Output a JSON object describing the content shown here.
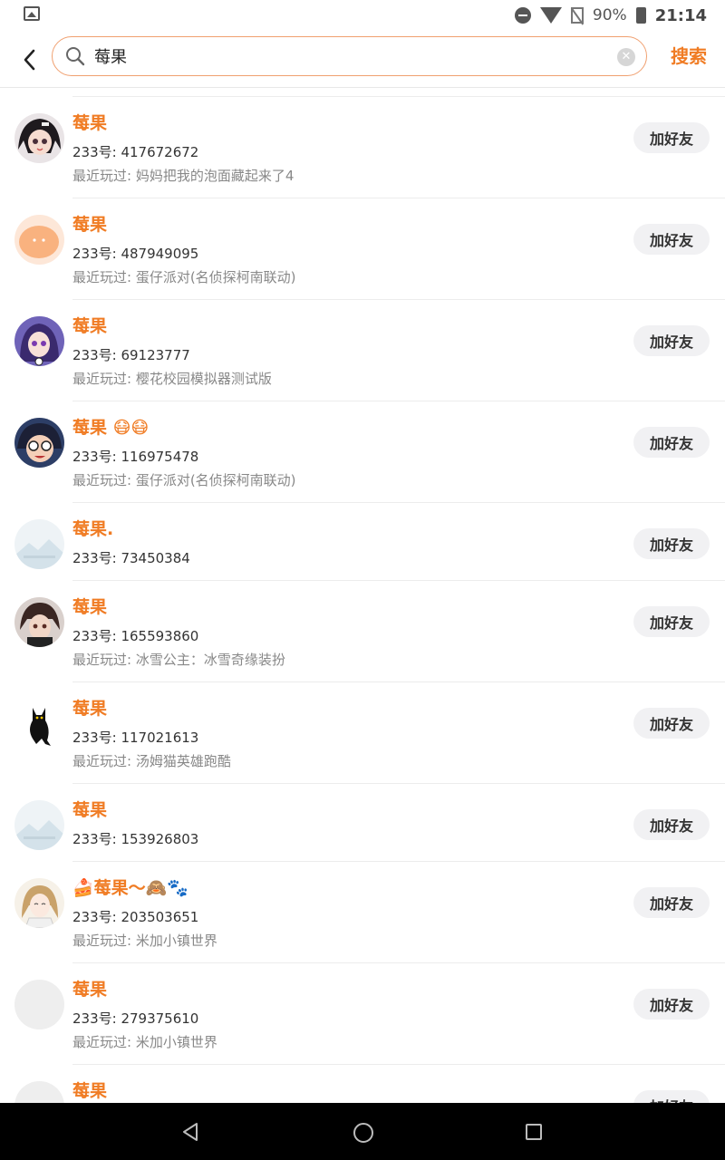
{
  "status_bar": {
    "battery": "90%",
    "time": "21:14"
  },
  "search": {
    "query": "莓果",
    "placeholder": "",
    "button_label": "搜索"
  },
  "results": [
    {
      "name": "莓果",
      "uid": "233号: 417672672",
      "recent": "最近玩过: 妈妈把我的泡面藏起来了4",
      "action": "加好友",
      "avatar": "anime-girl-dark-hair"
    },
    {
      "name": "莓果",
      "uid": "233号: 487949095",
      "recent": "最近玩过: 蛋仔派对(名侦探柯南联动)",
      "action": "加好友",
      "avatar": "orange-blob"
    },
    {
      "name": "莓果",
      "uid": "233号: 69123777",
      "recent": "最近玩过: 樱花校园模拟器测试版",
      "action": "加好友",
      "avatar": "anime-girl-purple"
    },
    {
      "name": "莓果 😷😷",
      "uid": "233号: 116975478",
      "recent": "最近玩过: 蛋仔派对(名侦探柯南联动)",
      "action": "加好友",
      "avatar": "anime-boy-glasses"
    },
    {
      "name": "莓果.",
      "uid": "233号: 73450384",
      "recent": "",
      "action": "加好友",
      "avatar": "default-landscape"
    },
    {
      "name": "莓果",
      "uid": "233号: 165593860",
      "recent": "最近玩过: 冰雪公主：冰雪奇缘装扮",
      "action": "加好友",
      "avatar": "anime-boy-brown"
    },
    {
      "name": "莓果",
      "uid": "233号: 117021613",
      "recent": "最近玩过: 汤姆猫英雄跑酷",
      "action": "加好友",
      "avatar": "black-cat"
    },
    {
      "name": "莓果",
      "uid": "233号: 153926803",
      "recent": "",
      "action": "加好友",
      "avatar": "default-landscape"
    },
    {
      "name": "🍰莓果〜🙈🐾",
      "uid": "233号: 203503651",
      "recent": "最近玩过: 米加小镇世界",
      "action": "加好友",
      "avatar": "anime-girl-light"
    },
    {
      "name": "莓果",
      "uid": "233号: 279375610",
      "recent": "最近玩过: 米加小镇世界",
      "action": "加好友",
      "avatar": "blank-grey"
    },
    {
      "name": "莓果",
      "uid": "",
      "recent": "",
      "action": "加好友",
      "avatar": "blank-grey"
    }
  ],
  "colors": {
    "accent": "#f07c24",
    "button_bg": "#f1f1f3",
    "nav_bg": "#000000"
  }
}
